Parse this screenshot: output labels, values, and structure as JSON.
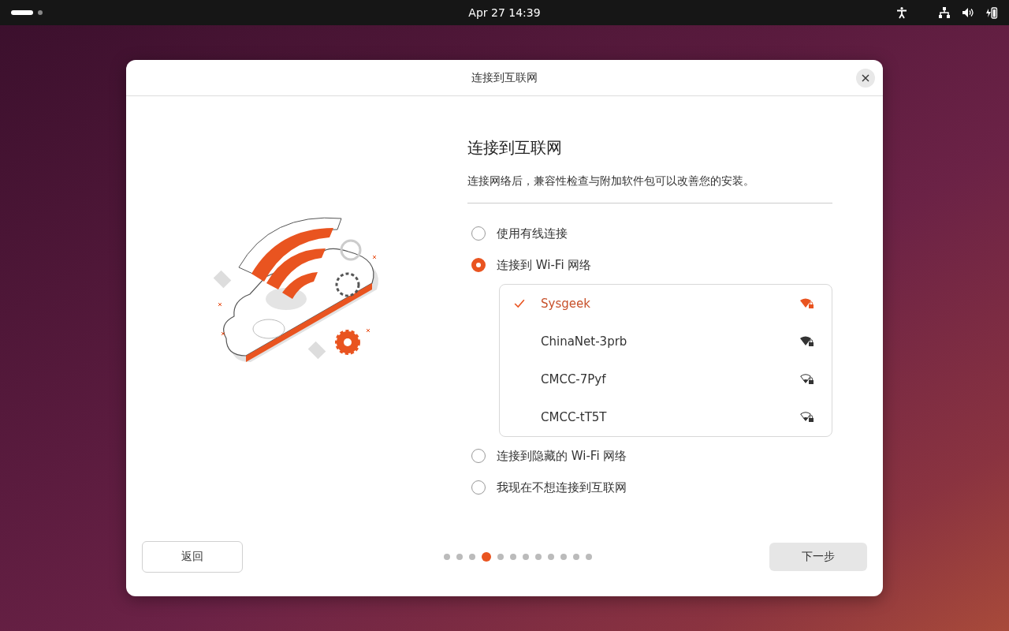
{
  "top_bar": {
    "clock": "Apr 27  14:39",
    "workspaces": [
      {
        "selected": true
      },
      {
        "selected": false
      }
    ]
  },
  "dialog": {
    "title": "连接到互联网",
    "heading": "连接到互联网",
    "description": "连接网络后，兼容性检查与附加软件包可以改善您的安装。",
    "options": [
      {
        "label": "使用有线连接",
        "selected": false
      },
      {
        "label": "连接到 Wi-Fi 网络",
        "selected": true
      },
      {
        "label": "连接到隐藏的 Wi-Fi 网络",
        "selected": false
      },
      {
        "label": "我现在不想连接到互联网",
        "selected": false
      }
    ],
    "networks": [
      {
        "name": "Sysgeek",
        "selected": true,
        "kind": "strong"
      },
      {
        "name": "ChinaNet-3prb",
        "selected": false,
        "kind": "strong"
      },
      {
        "name": "CMCC-7Pyf",
        "selected": false,
        "kind": "weak"
      },
      {
        "name": "CMCC-tT5T",
        "selected": false,
        "kind": "weak"
      }
    ],
    "back_button": "返回",
    "next_button": "下一步",
    "steps": [
      {
        "selected": false
      },
      {
        "selected": false
      },
      {
        "selected": false
      },
      {
        "selected": true
      },
      {
        "selected": false
      },
      {
        "selected": false
      },
      {
        "selected": false
      },
      {
        "selected": false
      },
      {
        "selected": false
      },
      {
        "selected": false
      },
      {
        "selected": false
      },
      {
        "selected": false
      }
    ]
  }
}
